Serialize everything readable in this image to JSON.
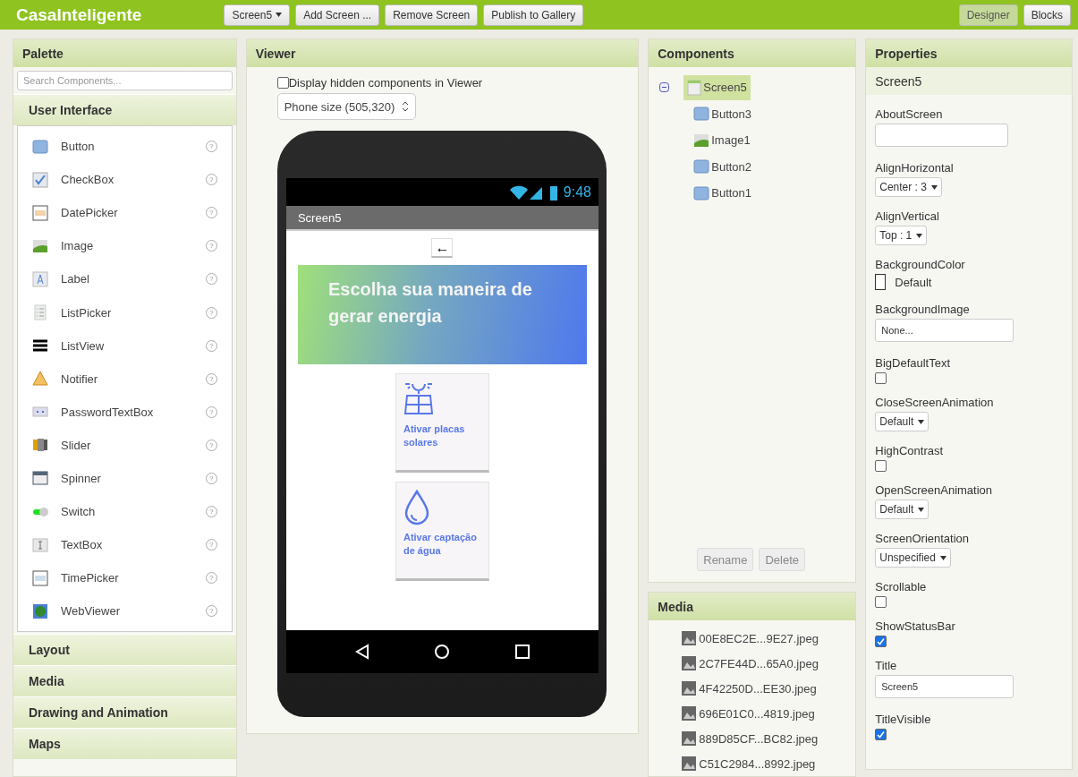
{
  "app": {
    "title": "CasaInteligente",
    "toolbar": [
      {
        "label": "Screen5",
        "kind": "dropdown"
      },
      {
        "label": "Add Screen ...",
        "kind": "button"
      },
      {
        "label": "Remove Screen",
        "kind": "button"
      },
      {
        "label": "Publish to Gallery",
        "kind": "button"
      }
    ],
    "modes": [
      {
        "label": "Designer",
        "selected": true
      },
      {
        "label": "Blocks",
        "selected": false
      }
    ]
  },
  "palette": {
    "title": "Palette",
    "search": {
      "placeholder": "Search Components..."
    },
    "open_section": "User Interface",
    "items": [
      {
        "label": "Button",
        "help": "?"
      },
      {
        "label": "CheckBox",
        "help": "?"
      },
      {
        "label": "DatePicker",
        "help": "?"
      },
      {
        "label": "Image",
        "help": "?"
      },
      {
        "label": "Label",
        "help": "?"
      },
      {
        "label": "ListPicker",
        "help": "?"
      },
      {
        "label": "ListView",
        "help": "?"
      },
      {
        "label": "Notifier",
        "help": "?"
      },
      {
        "label": "PasswordTextBox",
        "help": "?"
      },
      {
        "label": "Slider",
        "help": "?"
      },
      {
        "label": "Spinner",
        "help": "?"
      },
      {
        "label": "Switch",
        "help": "?"
      },
      {
        "label": "TextBox",
        "help": "?"
      },
      {
        "label": "TimePicker",
        "help": "?"
      },
      {
        "label": "WebViewer",
        "help": "?"
      }
    ],
    "sections": [
      "Layout",
      "Media",
      "Drawing and Animation",
      "Maps"
    ]
  },
  "viewer": {
    "title": "Viewer",
    "hidden_toggle": {
      "label": "Display hidden components in Viewer",
      "checked": false
    },
    "size_select": "Phone size (505,320)",
    "phone": {
      "time": "9:48",
      "screen_title": "Screen5",
      "back": "←",
      "banner": "Escolha sua maneira de gerar energia",
      "cards": [
        {
          "kind": "solar",
          "label": "Ativar placas solares"
        },
        {
          "kind": "water",
          "label": "Ativar captação de água"
        }
      ]
    }
  },
  "components": {
    "title": "Components",
    "tree": {
      "label": "Screen5",
      "kind": "screen",
      "expanded": true,
      "selected": true,
      "children": [
        {
          "label": "Button3",
          "kind": "button",
          "selected": false
        },
        {
          "label": "Image1",
          "kind": "image",
          "selected": false
        },
        {
          "label": "Button2",
          "kind": "button",
          "selected": false
        },
        {
          "label": "Button1",
          "kind": "button",
          "selected": false
        }
      ]
    },
    "buttons": [
      "Rename",
      "Delete"
    ]
  },
  "media": {
    "title": "Media",
    "files": [
      "00E8EC2E...9E27.jpeg",
      "2C7FE44D...65A0.jpeg",
      "4F42250D...EE30.jpeg",
      "696E01C0...4819.jpeg",
      "889D85CF...BC82.jpeg",
      "C51C2984...8992.jpeg"
    ]
  },
  "properties": {
    "title": "Properties",
    "component": "Screen5",
    "items": [
      {
        "name": "AboutScreen",
        "kind": "text"
      },
      {
        "name": "AlignHorizontal",
        "kind": "select",
        "value": "Center : 3"
      },
      {
        "name": "AlignVertical",
        "kind": "select",
        "value": "Top : 1"
      },
      {
        "name": "BackgroundColor",
        "kind": "color",
        "value": "Default"
      },
      {
        "name": "BackgroundImage",
        "kind": "text",
        "value": "None..."
      },
      {
        "name": "BigDefaultText",
        "kind": "checkbox",
        "checked": false
      },
      {
        "name": "CloseScreenAnimation",
        "kind": "select",
        "value": "Default"
      },
      {
        "name": "HighContrast",
        "kind": "checkbox",
        "checked": false
      },
      {
        "name": "OpenScreenAnimation",
        "kind": "select",
        "value": "Default"
      },
      {
        "name": "ScreenOrientation",
        "kind": "select",
        "value": "Unspecified"
      },
      {
        "name": "Scrollable",
        "kind": "checkbox",
        "checked": false
      },
      {
        "name": "ShowStatusBar",
        "kind": "checkbox",
        "checked": true
      },
      {
        "name": "Title",
        "kind": "text",
        "value": "Screen5"
      },
      {
        "name": "TitleVisible",
        "kind": "checkbox",
        "checked": true
      }
    ]
  }
}
